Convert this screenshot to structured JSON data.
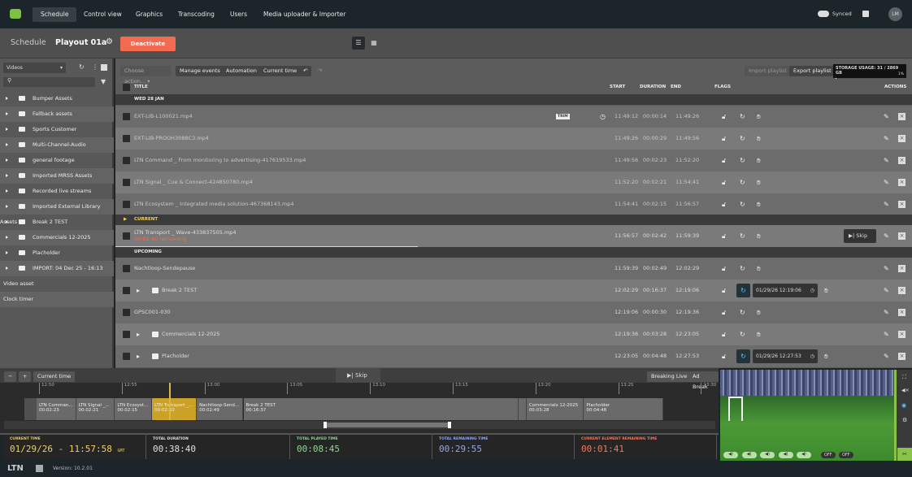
{
  "nav": {
    "items": [
      "Schedule",
      "Control view",
      "Graphics",
      "Transcoding",
      "Users",
      "Media uploader & Importer"
    ],
    "synced": "Synced",
    "avatar": "LM"
  },
  "header": {
    "section": "Schedule",
    "playout": "Playout 01a",
    "deactivate": "Deactivate"
  },
  "sidebar": {
    "dropdown": "Videos",
    "search_placeholder": "",
    "folders": [
      "Bumper Assets",
      "Fallback assets",
      "Sports Customer",
      "Multi-Channel-Audio",
      "general footage",
      "Imported MRSS Assets",
      "Recorded live streams",
      "Imported External Library Assets",
      "Break 2 TEST",
      "Commercials 12-2025",
      "Placholder",
      "IMPORT: 04 Dec 25 - 16:13"
    ],
    "extras": [
      "Video asset",
      "Clock timer"
    ]
  },
  "toolbar": {
    "choose": "Choose action...",
    "manage": "Manage events",
    "automation": "Automation",
    "current_time": "Current time",
    "import": "Import playlist",
    "export": "Export playlist",
    "storage": "STORAGE USAGE: 31 / 2869 GB",
    "storage_pct": "1%",
    "storage_fraction": 0.01
  },
  "columns": {
    "title": "TITLE",
    "start": "START",
    "duration": "DURATION",
    "end": "END",
    "flags": "FLAGS",
    "actions": "ACTIONS"
  },
  "groups": {
    "date": "WED 28 JAN",
    "current": "CURRENT",
    "upcoming": "UPCOMING"
  },
  "past_rows": [
    {
      "title": "EXT-LIB-L100021.mp4",
      "badge": "TRIM",
      "start": "11:49:12",
      "duration": "00:00:14",
      "end": "11:49:26"
    },
    {
      "title": "EXT-LIB-PROOH3088C3.mp4",
      "start": "11:49:26",
      "duration": "00:00:29",
      "end": "11:49:56"
    },
    {
      "title": "LTN Command _ From monitoring to advertising-417619533.mp4",
      "start": "11:49:56",
      "duration": "00:02:23",
      "end": "11:52:20"
    },
    {
      "title": "LTN Signal _ Cue & Connect-424850780.mp4",
      "start": "11:52:20",
      "duration": "00:02:21",
      "end": "11:54:41"
    },
    {
      "title": "LTN Ecosystem _ Integrated media solution-467368143.mp4",
      "start": "11:54:41",
      "duration": "00:02:15",
      "end": "11:56:57"
    }
  ],
  "current_row": {
    "title": "LTN Transport _ Wave-433837505.mp4",
    "remaining": "00:01:40 remaining",
    "start": "11:56:57",
    "duration": "00:02:42",
    "end": "11:59:39",
    "skip": "Skip",
    "progress": 0.38
  },
  "upcoming_rows": [
    {
      "title": "Nachtloop-Sendepause",
      "start": "11:59:39",
      "duration": "00:02:49",
      "end": "12:02:29"
    },
    {
      "title": "Break 2 TEST",
      "folder": true,
      "start": "12:02:29",
      "duration": "00:16:37",
      "end": "12:19:06",
      "scheduled": "01/29/26 12:19:06"
    },
    {
      "title": "GPSC001-030",
      "start": "12:19:06",
      "duration": "00:00:30",
      "end": "12:19:36"
    },
    {
      "title": "Commercials 12-2025",
      "folder": true,
      "start": "12:19:36",
      "duration": "00:03:28",
      "end": "12:23:05"
    },
    {
      "title": "Placholder",
      "folder": true,
      "start": "12:23:05",
      "duration": "00:04:48",
      "end": "12:27:53",
      "scheduled": "01/29/26 12:27:53"
    }
  ],
  "timeline": {
    "current_time": "Current time",
    "skip": "Skip",
    "breaking": "Breaking Live",
    "adbreak": "Ad Break",
    "ticks": [
      "12:50",
      "12:55",
      "13:00",
      "13:05",
      "13:10",
      "13:15",
      "13:20",
      "13:25",
      "13:30"
    ],
    "blocks": [
      {
        "title": "LTN Comman...",
        "dur": "00:02:23"
      },
      {
        "title": "LTN Signal _...",
        "dur": "00:02:21"
      },
      {
        "title": "LTN Ecosyst...",
        "dur": "00:02:15"
      },
      {
        "title": "LTN Transport _...",
        "dur": "00:02:42",
        "current": true
      },
      {
        "title": "Nachtloop-Send...",
        "dur": "00:02:49"
      },
      {
        "title": "Break 2 TEST",
        "dur": "00:16:37"
      },
      {
        "title": "",
        "dur": ""
      },
      {
        "title": "Commercials 12-2025",
        "dur": "00:03:28"
      },
      {
        "title": "Placholder",
        "dur": "00:04:48"
      }
    ]
  },
  "stats": [
    {
      "label": "CURRENT TIME",
      "value": "01/29/26 - 11:57:58",
      "suffix": "GMT",
      "color": "#f0d060"
    },
    {
      "label": "TOTAL DURATION",
      "value": "00:38:40",
      "color": "#e0e0e0"
    },
    {
      "label": "TOTAL PLAYED TIME",
      "value": "00:08:45",
      "color": "#8fd694"
    },
    {
      "label": "TOTAL REMAINING TIME",
      "value": "00:29:55",
      "color": "#8fa8f0"
    },
    {
      "label": "CURRENT ELEMENT REMAINING TIME",
      "value": "00:01:41",
      "color": "#f07860"
    }
  ],
  "preview": {
    "off1": "OFF",
    "off2": "OFF"
  },
  "footer": {
    "brand": "LTN",
    "version": "Version: 10.2.01"
  },
  "colors": {
    "accent": "#f26a4f",
    "current": "#c9a227",
    "brand": "#7cc242"
  }
}
